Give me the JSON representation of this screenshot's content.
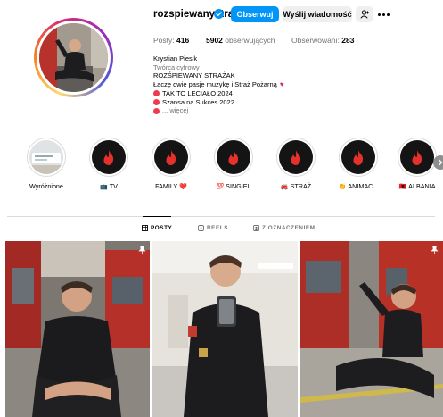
{
  "profile": {
    "username": "rozspiewanystrazak",
    "verified": true,
    "follow_label": "Obserwuj",
    "message_label": "Wyślij wiadomość",
    "stats": {
      "posts_value": "416",
      "posts_label": "Posty:",
      "followers_value": "5902",
      "followers_label": "obserwujących",
      "following_label": "Obserwowani:",
      "following_value": "283"
    },
    "bio": {
      "name": "Krystian Piesik",
      "category": "Twórca cyfrowy",
      "line1": "ROZŚPIEWANY STRAŻAK",
      "line2": "Łączę dwie pasje muzykę i Straż Pożarną",
      "line3": "TAK TO LECIAŁO 2024",
      "line4": "Szansa na Sukces 2022",
      "more": "... więcej"
    }
  },
  "highlights": [
    {
      "label": "Wyróżnione",
      "emoji": ""
    },
    {
      "label": "TV",
      "emoji": "📺"
    },
    {
      "label": "FAMILY",
      "emoji": "❤️"
    },
    {
      "label": "SINGIEL",
      "emoji": "💯"
    },
    {
      "label": "STRAŻ",
      "emoji": "🚒"
    },
    {
      "label": "ANIMAC...",
      "emoji": "👏"
    },
    {
      "label": "ALBANIA",
      "emoji": "🇦🇱"
    }
  ],
  "tabs": {
    "posts": "POSTY",
    "reels": "REELS",
    "tagged": "Z OZNACZENIEM"
  },
  "colors": {
    "accent": "#0095f6",
    "story_ring": [
      "#feda75",
      "#fa7e1e",
      "#d62976",
      "#962fbf",
      "#4f5bd5"
    ],
    "highlight_bg": "#141414",
    "flame": "#e4312b"
  }
}
